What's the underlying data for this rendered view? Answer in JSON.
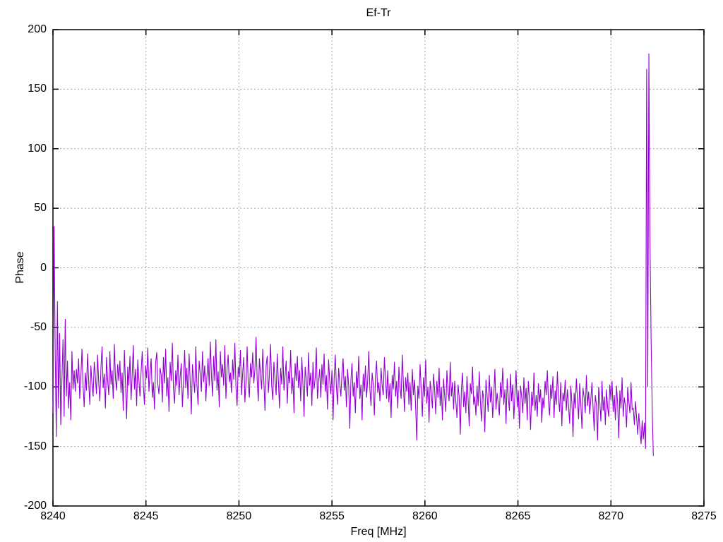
{
  "chart_data": {
    "type": "line",
    "title": "Ef-Tr",
    "xlabel": "Freq [MHz]",
    "ylabel": "Phase",
    "xlim": [
      8240,
      8275
    ],
    "ylim": [
      -200,
      200
    ],
    "x_ticks": [
      8240,
      8245,
      8250,
      8255,
      8260,
      8265,
      8270,
      8275
    ],
    "y_ticks": [
      -200,
      -150,
      -100,
      -50,
      0,
      50,
      100,
      150,
      200
    ],
    "grid": true,
    "legend_position": "none",
    "line_color": "#9400d3",
    "grid_color": "#a8a8a8",
    "border_color": "#000000",
    "series": [
      {
        "name": "Ef-Tr",
        "x_start": 8240.0,
        "x_step": 0.06,
        "values": [
          -122,
          35,
          -70,
          -142,
          -28,
          -118,
          -55,
          -132,
          -95,
          -60,
          -125,
          -43,
          -108,
          -78,
          -118,
          -96,
          -128,
          -70,
          -102,
          -86,
          -104,
          -85,
          -97,
          -76,
          -110,
          -92,
          -68,
          -99,
          -117,
          -88,
          -103,
          -72,
          -95,
          -115,
          -82,
          -98,
          -108,
          -79,
          -91,
          -106,
          -73,
          -96,
          -112,
          -84,
          -66,
          -101,
          -89,
          -118,
          -75,
          -94,
          -107,
          -70,
          -98,
          -86,
          -110,
          -64,
          -92,
          -103,
          -81,
          -95,
          -78,
          -105,
          -88,
          -120,
          -69,
          -97,
          -127,
          -83,
          -99,
          -74,
          -111,
          -90,
          -65,
          -102,
          -85,
          -116,
          -77,
          -94,
          -108,
          -87,
          -70,
          -99,
          -115,
          -82,
          -93,
          -67,
          -104,
          -88,
          -76,
          -109,
          -96,
          -119,
          -80,
          -71,
          -98,
          -106,
          -84,
          -90,
          -113,
          -75,
          -97,
          -68,
          -108,
          -92,
          -121,
          -79,
          -95,
          -63,
          -102,
          -114,
          -86,
          -99,
          -73,
          -107,
          -91,
          -80,
          -117,
          -95,
          -69,
          -101,
          -84,
          -110,
          -72,
          -96,
          -123,
          -81,
          -93,
          -105,
          -66,
          -98,
          -115,
          -78,
          -89,
          -104,
          -70,
          -96,
          -82,
          -112,
          -91,
          -76,
          -99,
          -62,
          -90,
          -108,
          -74,
          -95,
          -60,
          -103,
          -87,
          -117,
          -70,
          -92,
          -81,
          -99,
          -65,
          -110,
          -85,
          -73,
          -96,
          -88,
          -105,
          -77,
          -94,
          -63,
          -100,
          -116,
          -83,
          -92,
          -69,
          -107,
          -88,
          -75,
          -113,
          -95,
          -66,
          -98,
          -109,
          -80,
          -92,
          -71,
          -97,
          -85,
          -58,
          -94,
          -112,
          -76,
          -90,
          -102,
          -68,
          -96,
          -120,
          -82,
          -74,
          -105,
          -89,
          -64,
          -99,
          -111,
          -79,
          -93,
          -107,
          -72,
          -95,
          -118,
          -84,
          -98,
          -66,
          -103,
          -91,
          -78,
          -114,
          -87,
          -97,
          -69,
          -106,
          -92,
          -122,
          -80,
          -95,
          -74,
          -101,
          -86,
          -112,
          -75,
          -97,
          -125,
          -83,
          -94,
          -108,
          -71,
          -99,
          -88,
          -116,
          -79,
          -102,
          -92,
          -67,
          -110,
          -96,
          -85,
          -109,
          -81,
          -98,
          -72,
          -104,
          -90,
          -119,
          -77,
          -95,
          -106,
          -86,
          -128,
          -92,
          -73,
          -100,
          -115,
          -84,
          -97,
          -108,
          -88,
          -76,
          -103,
          -91,
          -117,
          -85,
          -99,
          -135,
          -94,
          -80,
          -108,
          -96,
          -122,
          -87,
          -101,
          -74,
          -110,
          -98,
          -128,
          -89,
          -104,
          -82,
          -109,
          -95,
          -70,
          -102,
          -116,
          -88,
          -98,
          -124,
          -91,
          -78,
          -105,
          -96,
          -112,
          -84,
          -99,
          -107,
          -75,
          -93,
          -110,
          -86,
          -113,
          -97,
          -126,
          -90,
          -102,
          -79,
          -108,
          -95,
          -118,
          -83,
          -100,
          -110,
          -73,
          -97,
          -121,
          -92,
          -104,
          -88,
          -115,
          -96,
          -120,
          -85,
          -107,
          -94,
          -117,
          -145,
          -99,
          -110,
          -81,
          -103,
          -125,
          -92,
          -108,
          -77,
          -114,
          -100,
          -130,
          -95,
          -105,
          -118,
          -89,
          -102,
          -123,
          -95,
          -109,
          -84,
          -116,
          -100,
          -128,
          -93,
          -107,
          -121,
          -86,
          -103,
          -112,
          -79,
          -108,
          -96,
          -119,
          -95,
          -112,
          -126,
          -98,
          -109,
          -140,
          -102,
          -88,
          -117,
          -104,
          -122,
          -91,
          -110,
          -133,
          -97,
          -106,
          -83,
          -115,
          -108,
          -124,
          -99,
          -116,
          -87,
          -112,
          -129,
          -103,
          -110,
          -138,
          -94,
          -107,
          -121,
          -90,
          -113,
          -100,
          -126,
          -108,
          -85,
          -119,
          -105,
          -114,
          -124,
          -96,
          -109,
          -84,
          -115,
          -102,
          -131,
          -93,
          -108,
          -120,
          -89,
          -112,
          -98,
          -127,
          -105,
          -86,
          -117,
          -103,
          -135,
          -99,
          -108,
          -122,
          -92,
          -114,
          -101,
          -128,
          -95,
          -111,
          -136,
          -104,
          -116,
          -88,
          -120,
          -107,
          -125,
          -97,
          -113,
          -102,
          -130,
          -109,
          -118,
          -95,
          -107,
          -86,
          -112,
          -124,
          -98,
          -110,
          -91,
          -126,
          -103,
          -115,
          -87,
          -109,
          -121,
          -96,
          -133,
          -105,
          -112,
          -94,
          -120,
          -102,
          -116,
          -131,
          -99,
          -113,
          -142,
          -105,
          -118,
          -93,
          -110,
          -127,
          -97,
          -114,
          -135,
          -101,
          -109,
          -122,
          -90,
          -116,
          -104,
          -123,
          -110,
          -96,
          -118,
          -137,
          -107,
          -115,
          -145,
          -100,
          -112,
          -129,
          -95,
          -120,
          -108,
          -132,
          -102,
          -117,
          -125,
          -98,
          -111,
          -95,
          -121,
          -107,
          -128,
          -99,
          -114,
          -143,
          -103,
          -118,
          -92,
          -125,
          -109,
          -116,
          -134,
          -100,
          -112,
          -122,
          -96,
          -119,
          -118,
          -132,
          -112,
          -126,
          -140,
          -122,
          -136,
          -148,
          -128,
          -144,
          -130,
          -152,
          167,
          -100,
          180,
          20,
          -60,
          -120,
          -158
        ]
      }
    ]
  }
}
